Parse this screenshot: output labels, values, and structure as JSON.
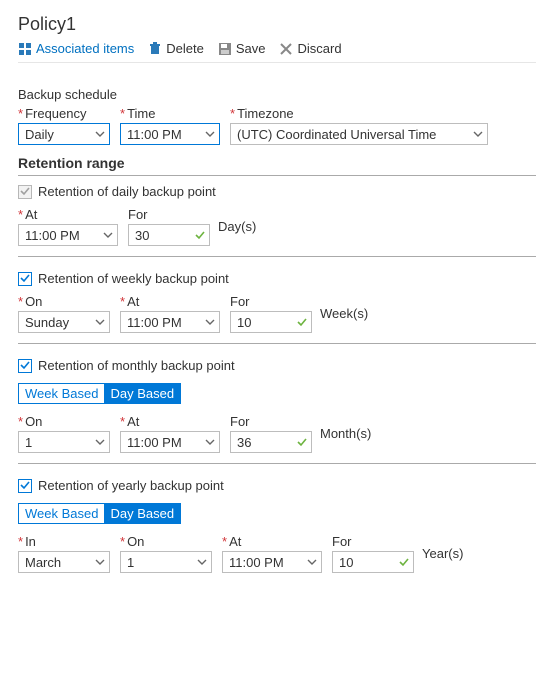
{
  "title": "Policy1",
  "toolbar": {
    "associated": "Associated items",
    "delete": "Delete",
    "save": "Save",
    "discard": "Discard"
  },
  "schedule": {
    "heading": "Backup schedule",
    "frequency_label": "Frequency",
    "frequency_value": "Daily",
    "time_label": "Time",
    "time_value": "11:00 PM",
    "timezone_label": "Timezone",
    "timezone_value": "(UTC) Coordinated Universal Time"
  },
  "retention": {
    "heading": "Retention range",
    "daily": {
      "label": "Retention of daily backup point",
      "at_label": "At",
      "at_value": "11:00 PM",
      "for_label": "For",
      "for_value": "30",
      "unit": "Day(s)"
    },
    "weekly": {
      "label": "Retention of weekly backup point",
      "on_label": "On",
      "on_value": "Sunday",
      "at_label": "At",
      "at_value": "11:00 PM",
      "for_label": "For",
      "for_value": "10",
      "unit": "Week(s)"
    },
    "monthly": {
      "label": "Retention of monthly backup point",
      "seg_week": "Week Based",
      "seg_day": "Day Based",
      "on_label": "On",
      "on_value": "1",
      "at_label": "At",
      "at_value": "11:00 PM",
      "for_label": "For",
      "for_value": "36",
      "unit": "Month(s)"
    },
    "yearly": {
      "label": "Retention of yearly backup point",
      "seg_week": "Week Based",
      "seg_day": "Day Based",
      "in_label": "In",
      "in_value": "March",
      "on_label": "On",
      "on_value": "1",
      "at_label": "At",
      "at_value": "11:00 PM",
      "for_label": "For",
      "for_value": "10",
      "unit": "Year(s)"
    }
  }
}
